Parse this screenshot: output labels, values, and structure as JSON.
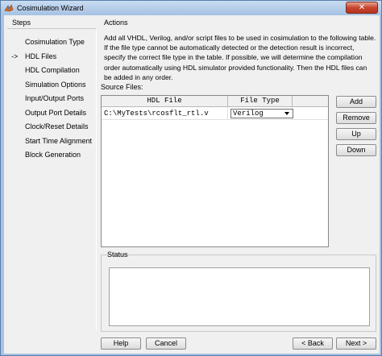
{
  "window": {
    "title": "Cosimulation Wizard",
    "close_symbol": "✕"
  },
  "steps": {
    "label": "Steps",
    "current_marker": "->",
    "items": [
      {
        "label": "Cosimulation Type",
        "current": false
      },
      {
        "label": "HDL Files",
        "current": true
      },
      {
        "label": "HDL Compilation",
        "current": false
      },
      {
        "label": "Simulation Options",
        "current": false
      },
      {
        "label": "Input/Output Ports",
        "current": false
      },
      {
        "label": "Output Port Details",
        "current": false
      },
      {
        "label": "Clock/Reset Details",
        "current": false
      },
      {
        "label": "Start Time Alignment",
        "current": false
      },
      {
        "label": "Block Generation",
        "current": false
      }
    ]
  },
  "actions": {
    "label": "Actions",
    "text": "Add all VHDL, Verilog, and/or script files to be used in cosimulation to the following table. If the file type cannot be automatically detected or the detection result is incorrect, specify the correct file type in the table. If possible, we will determine the compilation order automatically using HDL simulator provided functionality. Then the HDL files can be added in any order."
  },
  "source_files": {
    "label": "Source Files:",
    "columns": [
      "HDL File",
      "File Type",
      ""
    ],
    "rows": [
      {
        "file": "C:\\MyTests\\rcosflt_rtl.v",
        "type": "Verilog"
      }
    ]
  },
  "side_buttons": {
    "add": "Add",
    "remove": "Remove",
    "up": "Up",
    "down": "Down"
  },
  "status": {
    "label": "Status",
    "text": ""
  },
  "footer": {
    "help": "Help",
    "cancel": "Cancel",
    "back": "< Back",
    "next": "Next >"
  }
}
